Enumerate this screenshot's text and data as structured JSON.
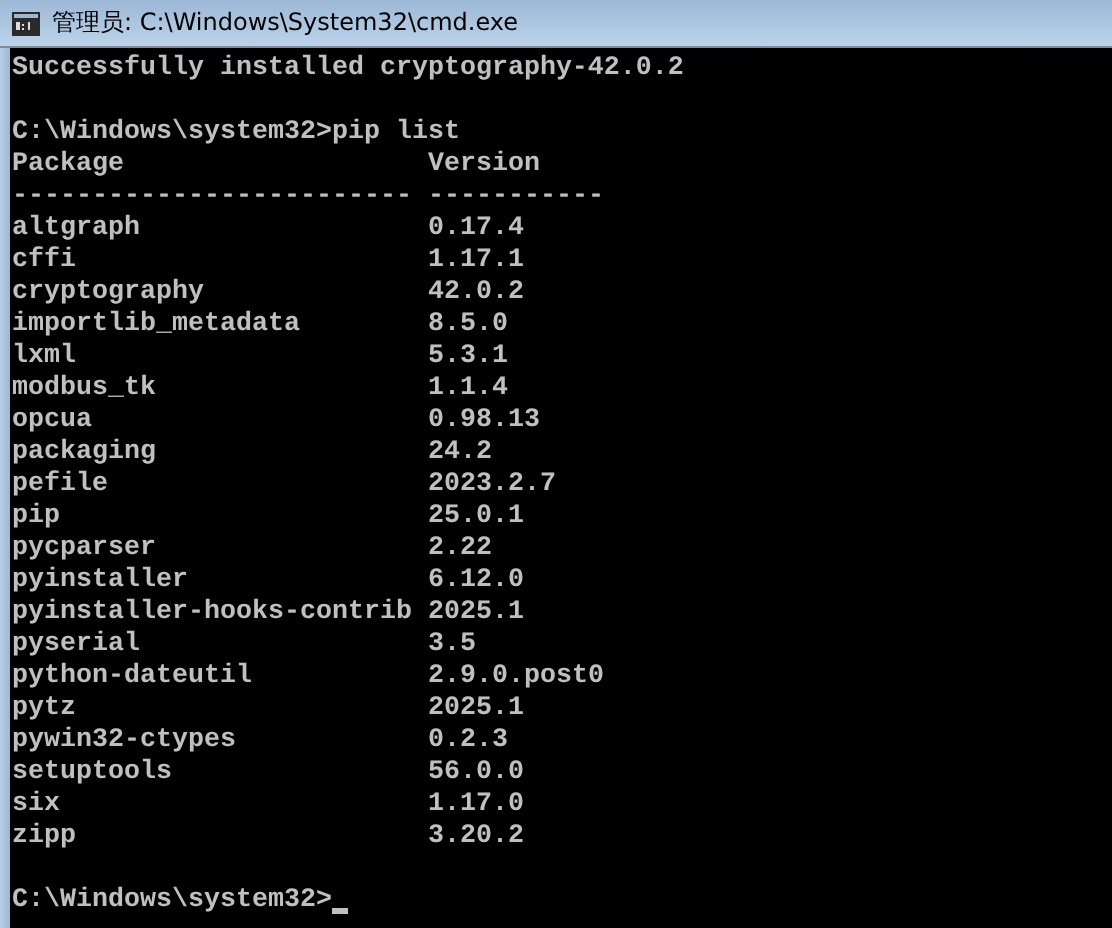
{
  "window": {
    "title": "管理员: C:\\Windows\\System32\\cmd.exe"
  },
  "console": {
    "output": "Successfully installed cryptography-42.0.2",
    "command": {
      "prompt": "C:\\Windows\\system32>",
      "input": "pip list"
    },
    "columns": [
      "Package",
      "Version"
    ],
    "rules": [
      "-------------------------",
      "-----------"
    ],
    "packages": [
      {
        "name": "altgraph",
        "version": "0.17.4"
      },
      {
        "name": "cffi",
        "version": "1.17.1"
      },
      {
        "name": "cryptography",
        "version": "42.0.2"
      },
      {
        "name": "importlib_metadata",
        "version": "8.5.0"
      },
      {
        "name": "lxml",
        "version": "5.3.1"
      },
      {
        "name": "modbus_tk",
        "version": "1.1.4"
      },
      {
        "name": "opcua",
        "version": "0.98.13"
      },
      {
        "name": "packaging",
        "version": "24.2"
      },
      {
        "name": "pefile",
        "version": "2023.2.7"
      },
      {
        "name": "pip",
        "version": "25.0.1"
      },
      {
        "name": "pycparser",
        "version": "2.22"
      },
      {
        "name": "pyinstaller",
        "version": "6.12.0"
      },
      {
        "name": "pyinstaller-hooks-contrib",
        "version": "2025.1"
      },
      {
        "name": "pyserial",
        "version": "3.5"
      },
      {
        "name": "python-dateutil",
        "version": "2.9.0.post0"
      },
      {
        "name": "pytz",
        "version": "2025.1"
      },
      {
        "name": "pywin32-ctypes",
        "version": "0.2.3"
      },
      {
        "name": "setuptools",
        "version": "56.0.0"
      },
      {
        "name": "six",
        "version": "1.17.0"
      },
      {
        "name": "zipp",
        "version": "3.20.2"
      }
    ],
    "final_prompt": {
      "prompt": "C:\\Windows\\system32>",
      "cursor": true
    }
  }
}
